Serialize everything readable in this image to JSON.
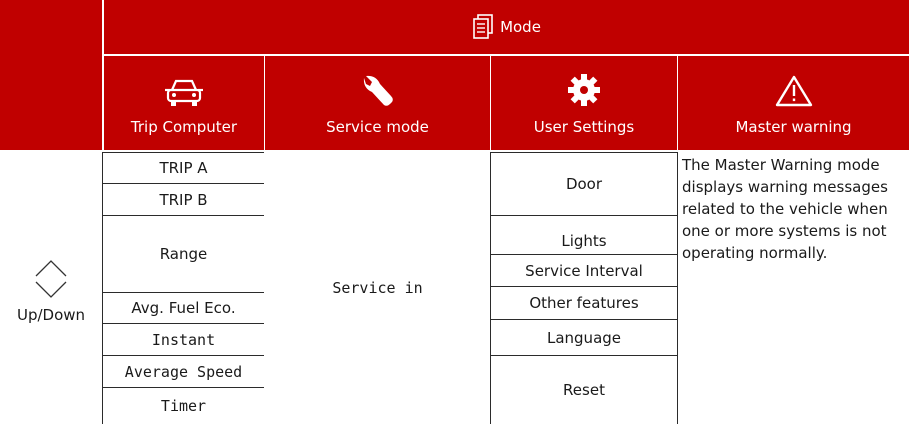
{
  "header": {
    "mode_label": "Mode"
  },
  "columns": [
    {
      "icon": "car-icon",
      "label": "Trip Computer"
    },
    {
      "icon": "wrench-icon",
      "label": "Service mode"
    },
    {
      "icon": "gear-icon",
      "label": "User Settings"
    },
    {
      "icon": "warning-triangle-icon",
      "label": "Master warning"
    }
  ],
  "row_label": {
    "icon": "up-down-arrows-icon",
    "text": "Up/Down"
  },
  "trip_computer_items": [
    "TRIP A",
    "TRIP B",
    "Range",
    "Avg. Fuel Eco.",
    "Instant",
    "Average Speed",
    "Timer"
  ],
  "service_mode_item": "Service in",
  "user_settings_items": [
    "Door",
    "Lights",
    "Service Interval",
    "Other features",
    "Language",
    "Reset"
  ],
  "master_warning_text": "The Master Warning mode displays warning messages related to the vehicle when one or more systems is not operating normally.",
  "colors": {
    "header_red": "#c00000",
    "text_white": "#ffffff",
    "border": "#2b2b2b"
  }
}
